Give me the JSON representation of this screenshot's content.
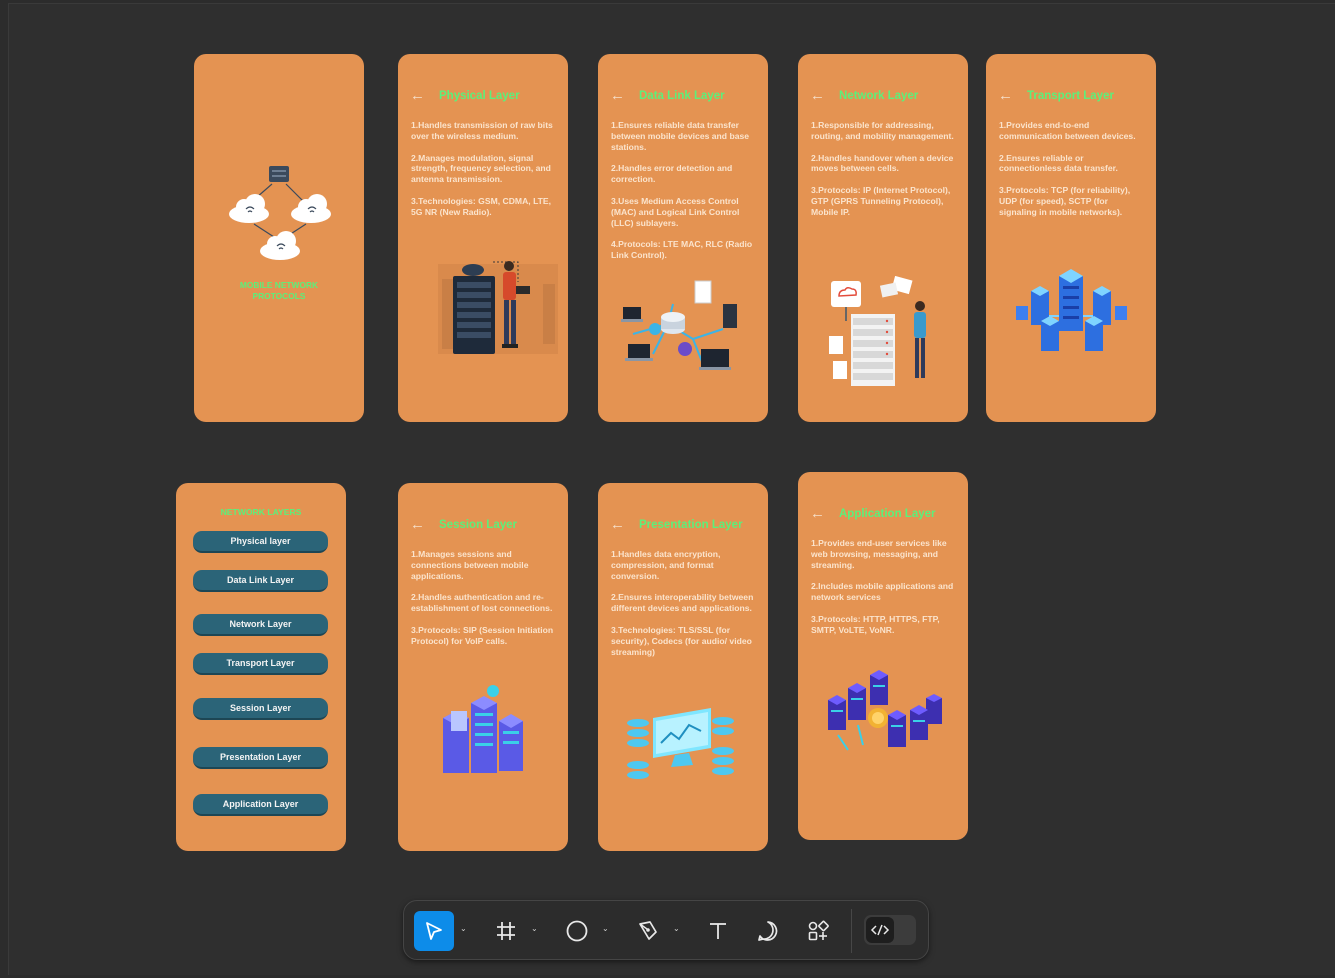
{
  "cover": {
    "title_line1": "MOBILE NETWORK",
    "title_line2": "PROTOCOLS"
  },
  "back_icon": "←",
  "physical": {
    "title": "Physical Layer",
    "points": [
      "1.Handles transmission of raw bits over the wireless medium.",
      "2.Manages modulation, signal strength, frequency selection, and antenna transmission.",
      "3.Technologies: GSM, CDMA, LTE, 5G NR (New Radio)."
    ]
  },
  "datalink": {
    "title": "Data Link Layer",
    "points": [
      "1.Ensures reliable data transfer between mobile devices and base stations.",
      "2.Handles error detection and correction.",
      "3.Uses Medium Access Control (MAC) and Logical Link Control (LLC) sublayers.",
      "4.Protocols: LTE MAC, RLC (Radio Link Control)."
    ]
  },
  "network": {
    "title": "Network Layer",
    "points": [
      "1.Responsible for addressing, routing, and mobility management.",
      "2.Handles handover when a device moves between cells.",
      "3.Protocols: IP (Internet Protocol), GTP (GPRS Tunneling Protocol), Mobile IP."
    ]
  },
  "transport": {
    "title": "Transport Layer",
    "points": [
      "1.Provides end-to-end communication between devices.",
      "2.Ensures reliable or connectionless data transfer.",
      "3.Protocols: TCP (for reliability), UDP (for speed), SCTP (for signaling in mobile networks)."
    ]
  },
  "layers_menu": {
    "title": "NETWORK LAYERS",
    "buttons": [
      "Physical layer",
      "Data Link Layer",
      "Network Layer",
      "Transport Layer",
      "Session Layer",
      "Presentation Layer",
      "Application Layer"
    ]
  },
  "session": {
    "title": "Session Layer",
    "points": [
      "1.Manages sessions and connections between mobile applications.",
      "2.Handles authentication and re-establishment of lost connections.",
      "3.Protocols: SIP (Session Initiation Protocol) for VoIP calls."
    ]
  },
  "presentation": {
    "title": "Presentation Layer",
    "points": [
      "1.Handles data encryption, compression, and format conversion.",
      "2.Ensures interoperability between different devices and applications.",
      "3.Technologies: TLS/SSL (for security), Codecs (for audio/ video streaming)"
    ]
  },
  "application": {
    "title": "Application Layer",
    "points": [
      "1.Provides end-user services like web browsing, messaging, and streaming.",
      "2.Includes mobile applications and network services",
      "3.Protocols: HTTP, HTTPS, FTP, SMTP, VoLTE, VoNR."
    ]
  },
  "toolbar": {
    "tools": [
      "move-tool",
      "frame-tool",
      "shape-tool",
      "pen-tool",
      "text-tool",
      "comment-tool",
      "actions-tool",
      "dev-mode-toggle"
    ]
  },
  "colors": {
    "card": "#e49352",
    "title_green": "#5cf07a",
    "button_teal": "#2b6478",
    "canvas": "#2f2f2f",
    "accent_blue": "#0d8ce9"
  }
}
